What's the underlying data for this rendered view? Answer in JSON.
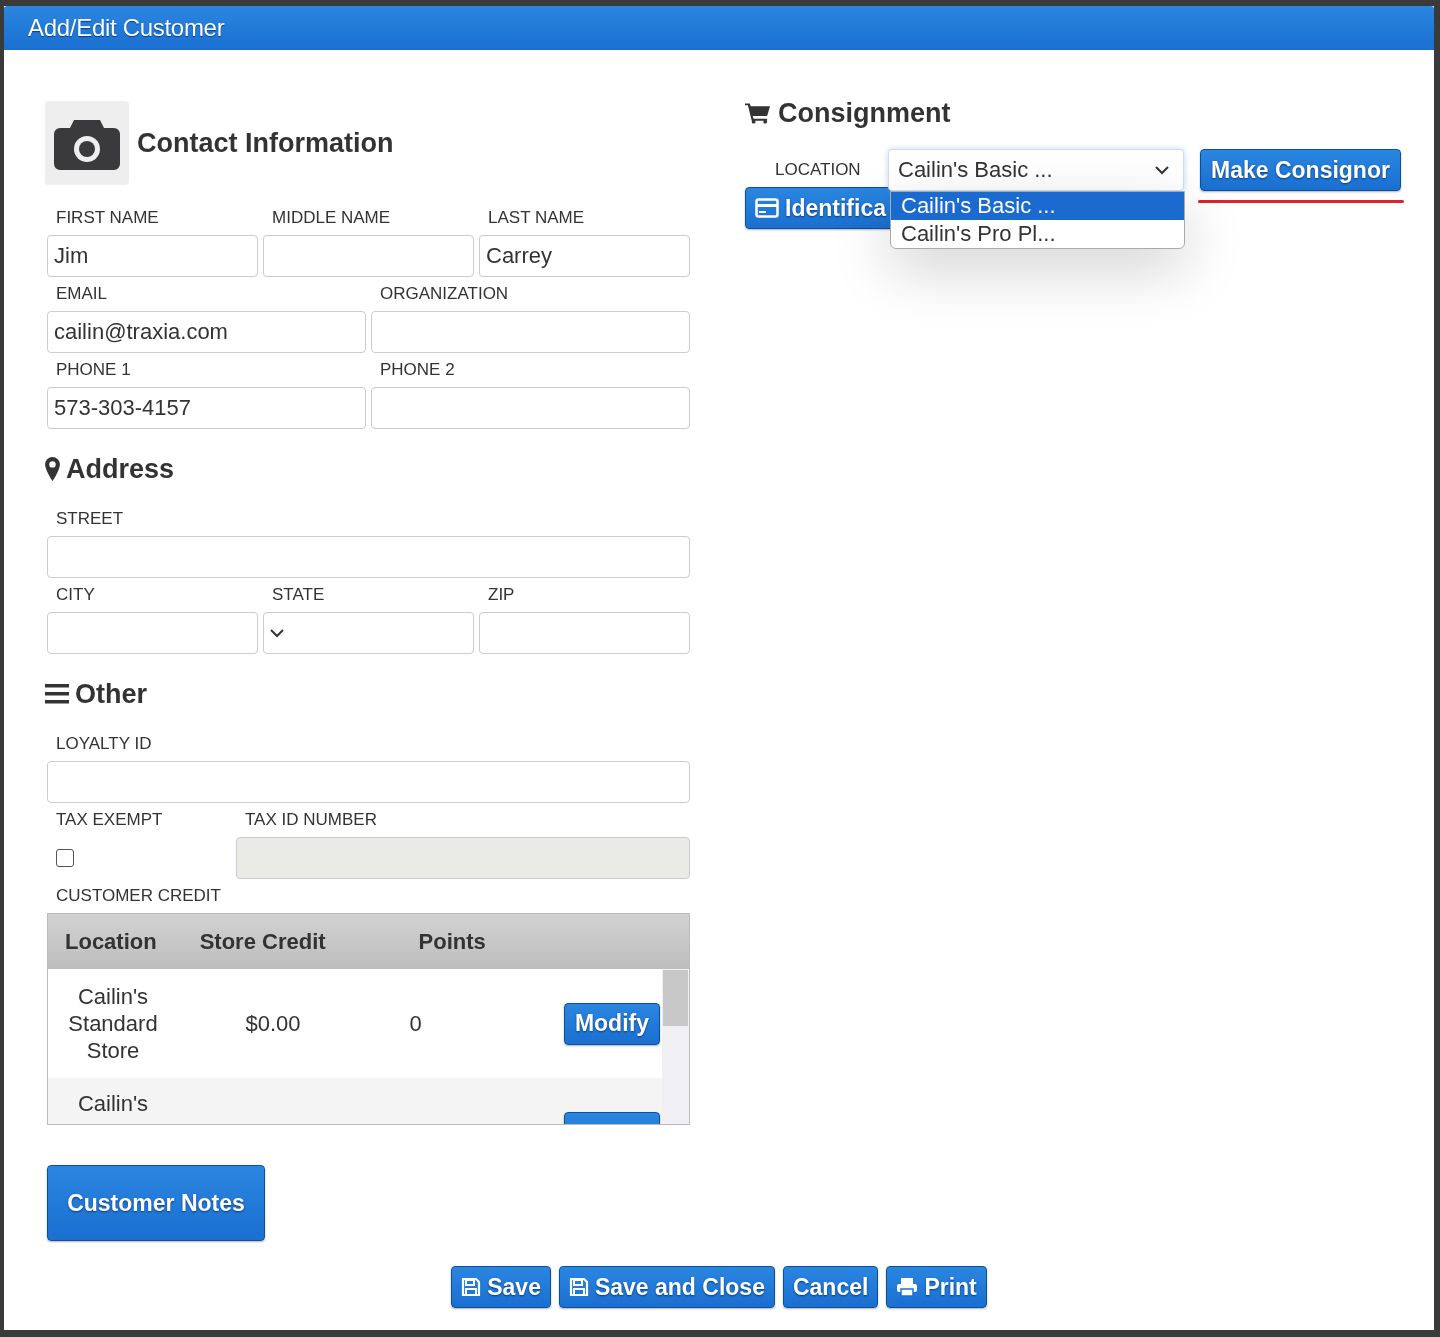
{
  "dialog": {
    "title": "Add/Edit Customer"
  },
  "contact": {
    "heading": "Contact Information",
    "rows": [
      [
        {
          "kind": "text",
          "label": "FIRST NAME",
          "value": "Jim"
        },
        {
          "kind": "text",
          "label": "MIDDLE NAME"
        },
        {
          "kind": "text",
          "label": "LAST NAME",
          "value": "Carrey"
        }
      ],
      [
        {
          "kind": "text",
          "label": "EMAIL",
          "value": "cailin@traxia.com"
        },
        {
          "kind": "text",
          "label": "ORGANIZATION"
        }
      ],
      [
        {
          "kind": "text",
          "label": "PHONE 1",
          "value": "573-303-4157"
        },
        {
          "kind": "text",
          "label": "PHONE 2"
        }
      ]
    ]
  },
  "address": {
    "heading": "Address",
    "rows": [
      [
        {
          "kind": "text",
          "label": "STREET"
        }
      ],
      [
        {
          "kind": "text",
          "label": "CITY"
        },
        {
          "kind": "select",
          "label": "STATE"
        },
        {
          "kind": "text",
          "label": "ZIP"
        }
      ]
    ]
  },
  "other": {
    "heading": "Other",
    "rows": [
      [
        {
          "kind": "text",
          "label": "LOYALTY ID",
          "disabled": false
        }
      ],
      [
        {
          "kind": "checkbox",
          "label": "TAX EXEMPT",
          "checked": false,
          "disabled": false
        },
        {
          "kind": "text",
          "label": "TAX ID NUMBER",
          "disabled": true
        }
      ]
    ]
  },
  "credit": {
    "label": "CUSTOMER CREDIT",
    "columns": [
      "Location",
      "Store Credit",
      "Points"
    ],
    "rows": [
      {
        "location": "Cailin's Standard Store",
        "credit": "$0.00",
        "points": "0",
        "action": "Modify"
      },
      {
        "location": "Cailin's"
      }
    ]
  },
  "notes_button": "Customer Notes",
  "consignment": {
    "heading": "Consignment",
    "location_label": "LOCATION",
    "location_value": "Cailin's Basic ...",
    "options": [
      {
        "label": "Cailin's Basic ...",
        "selected": true
      },
      {
        "label": "Cailin's Pro Pl...",
        "selected": false
      }
    ],
    "make_button": "Make Consignor",
    "id_button": "Identifica"
  },
  "footer_buttons": [
    {
      "label": "Save",
      "kind": "save"
    },
    {
      "label": "Save and Close",
      "kind": "save"
    },
    {
      "label": "Cancel",
      "kind": "cancel"
    },
    {
      "label": "Print",
      "kind": "print"
    }
  ]
}
